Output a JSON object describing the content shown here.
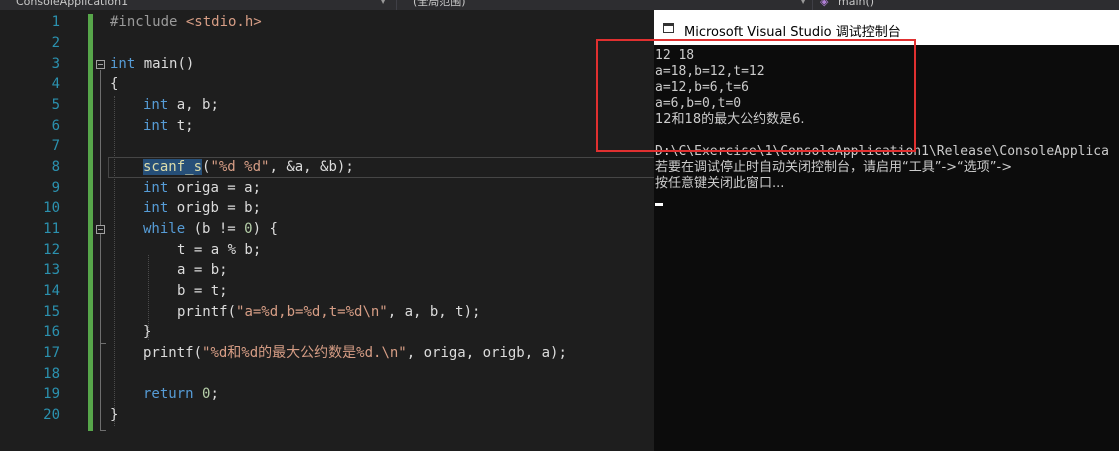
{
  "navbar": {
    "project": "ConsoleApplication1",
    "scope": "(全局范围)",
    "member": "main()"
  },
  "editor": {
    "line_numbers": [
      "1",
      "2",
      "3",
      "4",
      "5",
      "6",
      "7",
      "8",
      "9",
      "10",
      "11",
      "12",
      "13",
      "14",
      "15",
      "16",
      "17",
      "18",
      "19",
      "20"
    ],
    "code": {
      "l1_pre": "#include ",
      "l1_inc": "<stdio.h>",
      "l3_kw": "int",
      "l3_rest": " main()",
      "l4": "{",
      "l5_kw": "int",
      "l5_rest": " a, b;",
      "l6_kw": "int",
      "l6_rest": " t;",
      "l8_fn": "scanf_s",
      "l8_open": "(",
      "l8_str": "\"%d %d\"",
      "l8_rest": ", &a, &b);",
      "l9_kw": "int",
      "l9_rest": " origa = a;",
      "l10_kw": "int",
      "l10_rest": " origb = b;",
      "l11_kw": "while",
      "l11_a": " (b != ",
      "l11_num": "0",
      "l11_b": ") {",
      "l12": "t = a % b;",
      "l13": "a = b;",
      "l14": "b = t;",
      "l15_fn": "printf(",
      "l15_str": "\"a=%d,b=%d,t=%d\\n\"",
      "l15_rest": ", a, b, t);",
      "l16": "}",
      "l17_fn": "printf(",
      "l17_str": "\"%d和%d的最大公约数是%d.\\n\"",
      "l17_rest": ", origa, origb, a);",
      "l19_kw": "return",
      "l19_sp": " ",
      "l19_num": "0",
      "l19_end": ";",
      "l20": "}"
    }
  },
  "console": {
    "title": "Microsoft Visual Studio 调试控制台",
    "lines": [
      "12 18",
      "a=18,b=12,t=12",
      "a=12,b=6,t=6",
      "a=6,b=0,t=0",
      "12和18的最大公约数是6.",
      "",
      "D:\\C\\Exercise\\1\\ConsoleApplication1\\Release\\ConsoleApplica",
      "若要在调试停止时自动关闭控制台，请启用“工具”->“选项”->",
      "按任意键关闭此窗口..."
    ]
  },
  "colors": {
    "annotation_box": "#e03030",
    "line_numbers": "#2b91af",
    "keyword": "#569cd6",
    "string": "#d69d85"
  }
}
